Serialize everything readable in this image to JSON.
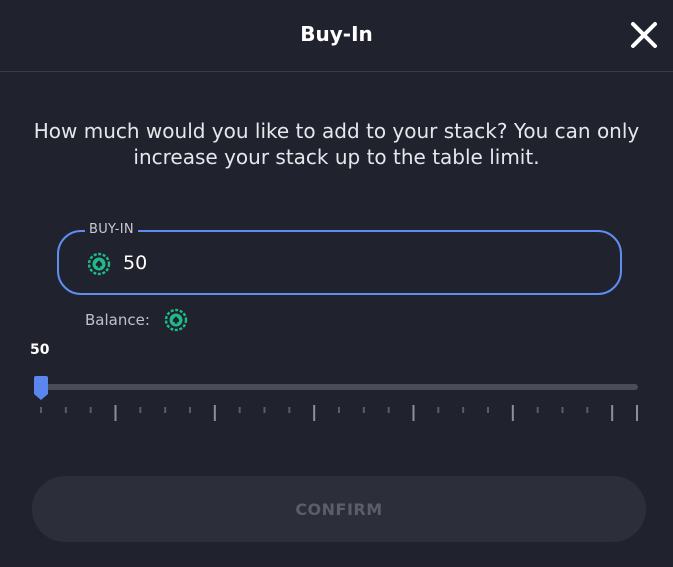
{
  "dialog": {
    "title": "Buy-In",
    "prompt": "How much would you like to add to your stack? You can only increase your stack up to the table limit."
  },
  "buyin_field": {
    "label": "BUY-IN",
    "value": "50",
    "icon": "chip-icon"
  },
  "balance": {
    "label": "Balance:",
    "icon": "chip-icon"
  },
  "slider": {
    "value_label": "50",
    "fraction": 0.0
  },
  "confirm": {
    "label": "CONFIRM",
    "enabled": false
  },
  "colors": {
    "background": "#20222d",
    "accent": "#5b86ee",
    "chip": "#1fb98a",
    "disabled_text": "#5b5e69"
  }
}
